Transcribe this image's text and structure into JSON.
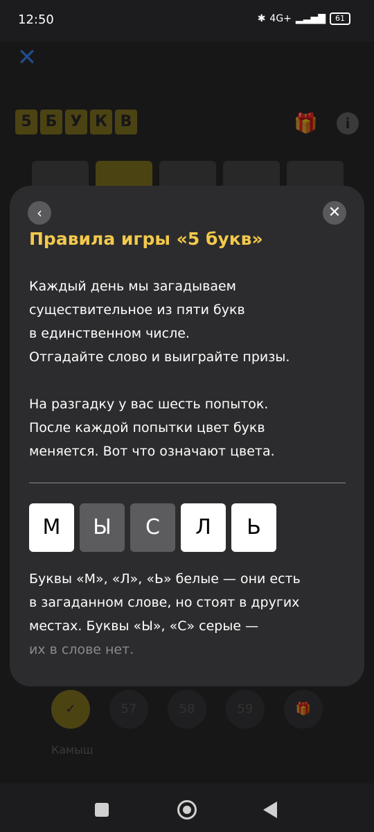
{
  "status": {
    "time": "12:50",
    "battery": "61",
    "network": "4G+"
  },
  "background": {
    "logo_letters": [
      "5",
      "Б",
      "У",
      "К",
      "В"
    ],
    "progress": [
      "57",
      "58",
      "59"
    ],
    "last_word": "Камыш"
  },
  "modal": {
    "title": "Правила игры «5 букв»",
    "paragraph1": [
      "Каждый день мы загадываем",
      "существительное из пяти букв",
      "в единственном числе.",
      "Отгадайте слово и выиграйте призы."
    ],
    "paragraph2": [
      "На разгадку у вас шесть попыток.",
      "После каждой попытки цвет букв",
      "меняется. Вот что означают цвета."
    ],
    "example_tiles": [
      {
        "letter": "М",
        "state": "white"
      },
      {
        "letter": "Ы",
        "state": "gray"
      },
      {
        "letter": "С",
        "state": "gray"
      },
      {
        "letter": "Л",
        "state": "white"
      },
      {
        "letter": "Ь",
        "state": "white"
      }
    ],
    "paragraph3": [
      "Буквы «М», «Л», «Ь» белые — они есть",
      "в загаданном слове, но стоят в других",
      "местах. Буквы «Ы», «С» серые —"
    ],
    "paragraph3_faded": "их в слове нет."
  },
  "colors": {
    "accent": "#f2c94c",
    "close_blue": "#3c8cff",
    "modal_bg": "#2c2c2e"
  }
}
